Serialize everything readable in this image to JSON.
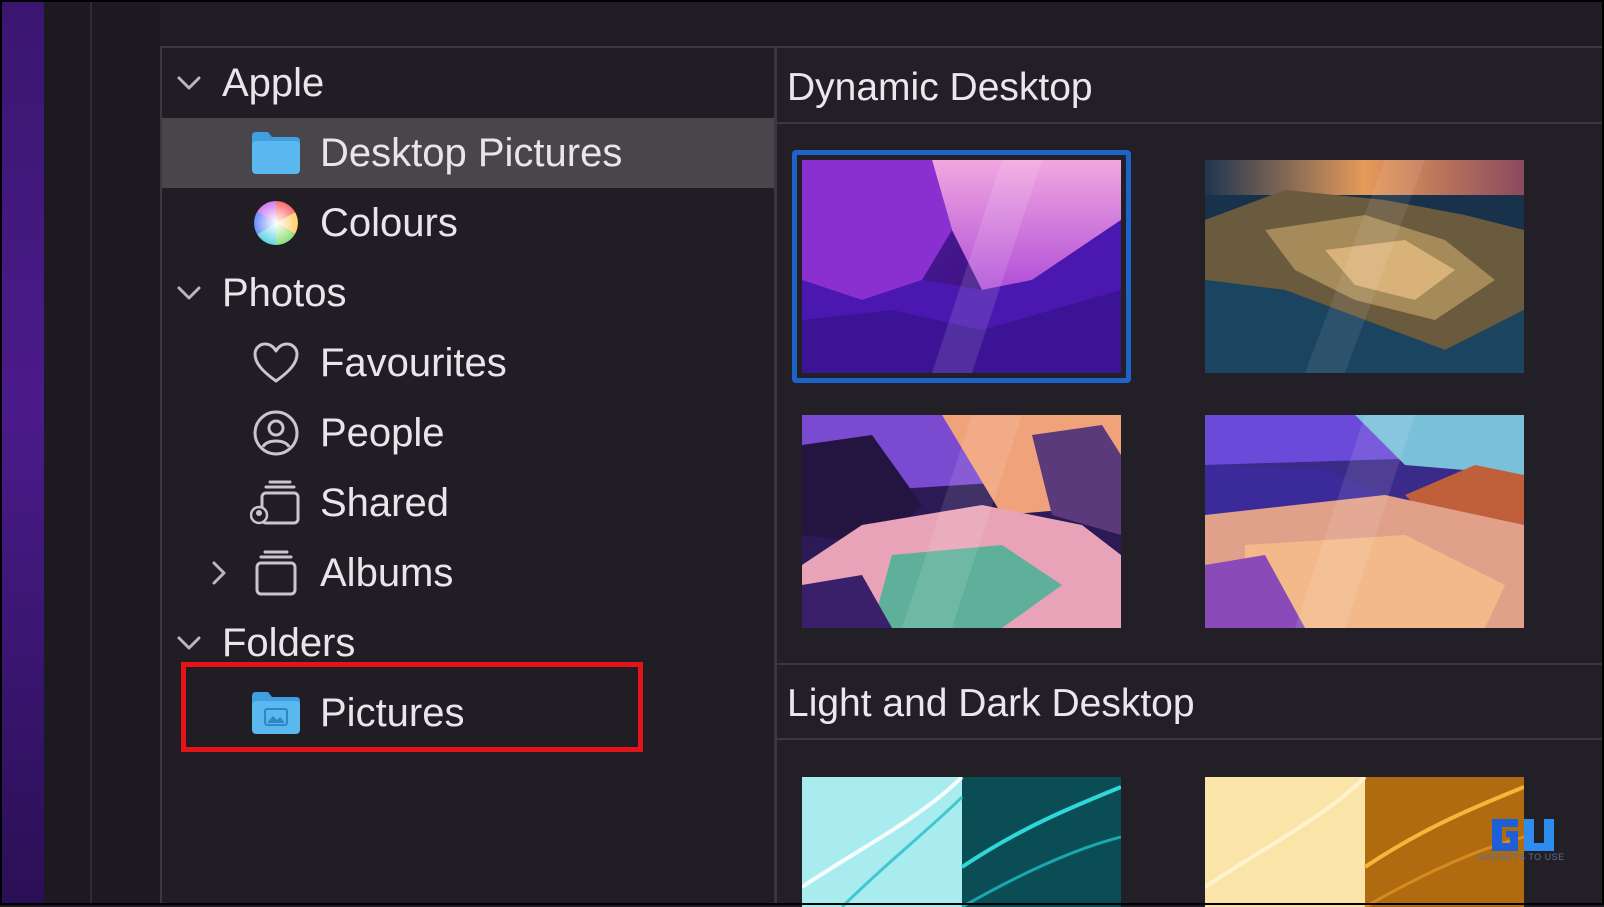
{
  "sidebar": {
    "groups": [
      {
        "label": "Apple",
        "expanded": true
      },
      {
        "label": "Photos",
        "expanded": true
      },
      {
        "label": "Folders",
        "expanded": true
      }
    ],
    "items": [
      {
        "label": "Desktop Pictures",
        "icon": "folder-icon",
        "selected": true
      },
      {
        "label": "Colours",
        "icon": "color-wheel-icon"
      },
      {
        "label": "Favourites",
        "icon": "heart-icon"
      },
      {
        "label": "People",
        "icon": "person-circle-icon"
      },
      {
        "label": "Shared",
        "icon": "shared-album-icon"
      },
      {
        "label": "Albums",
        "icon": "albums-stack-icon",
        "collapsed": true
      },
      {
        "label": "Pictures",
        "icon": "pictures-folder-icon",
        "highlighted": true
      }
    ]
  },
  "content": {
    "sections": [
      {
        "title": "Dynamic Desktop",
        "thumbnails": [
          "Monterey purple",
          "Big Sur coast",
          "Big Sur valley",
          "Big Sur desert"
        ],
        "selected_index": 0
      },
      {
        "title": "Light and Dark Desktop",
        "thumbnails": [
          "Teal abstract",
          "Gold abstract"
        ]
      }
    ]
  },
  "watermark": {
    "logo": "GU",
    "text": "GADGETS TO USE"
  },
  "colors": {
    "selection": "#1f63c9",
    "highlight": "#e3151b",
    "folder": "#5ab8ef"
  }
}
